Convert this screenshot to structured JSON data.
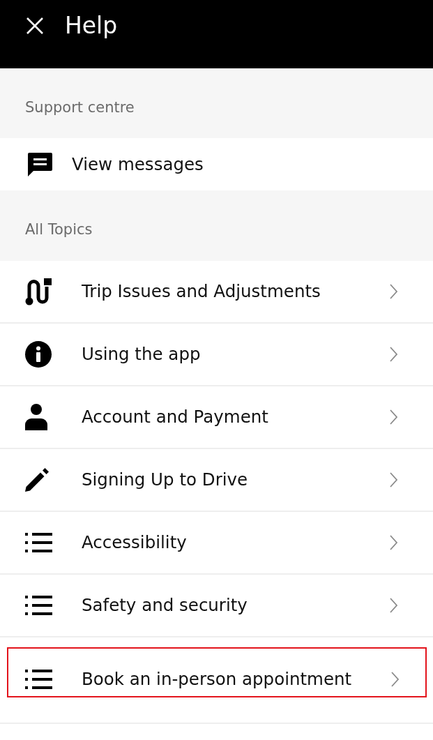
{
  "header": {
    "title": "Help"
  },
  "support_centre": {
    "heading": "Support centre",
    "items": [
      {
        "kind": "message",
        "label": "View messages"
      }
    ]
  },
  "all_topics": {
    "heading": "All Topics",
    "items": [
      {
        "kind": "route",
        "label": "Trip Issues and Adjustments",
        "highlighted": false
      },
      {
        "kind": "info",
        "label": "Using the app",
        "highlighted": false
      },
      {
        "kind": "person",
        "label": "Account and Payment",
        "highlighted": false
      },
      {
        "kind": "pencil",
        "label": "Signing Up to Drive",
        "highlighted": false
      },
      {
        "kind": "list",
        "label": "Accessibility",
        "highlighted": false
      },
      {
        "kind": "list",
        "label": "Safety and security",
        "highlighted": false
      },
      {
        "kind": "list",
        "label": "Book an in-person appointment",
        "highlighted": true
      }
    ]
  }
}
